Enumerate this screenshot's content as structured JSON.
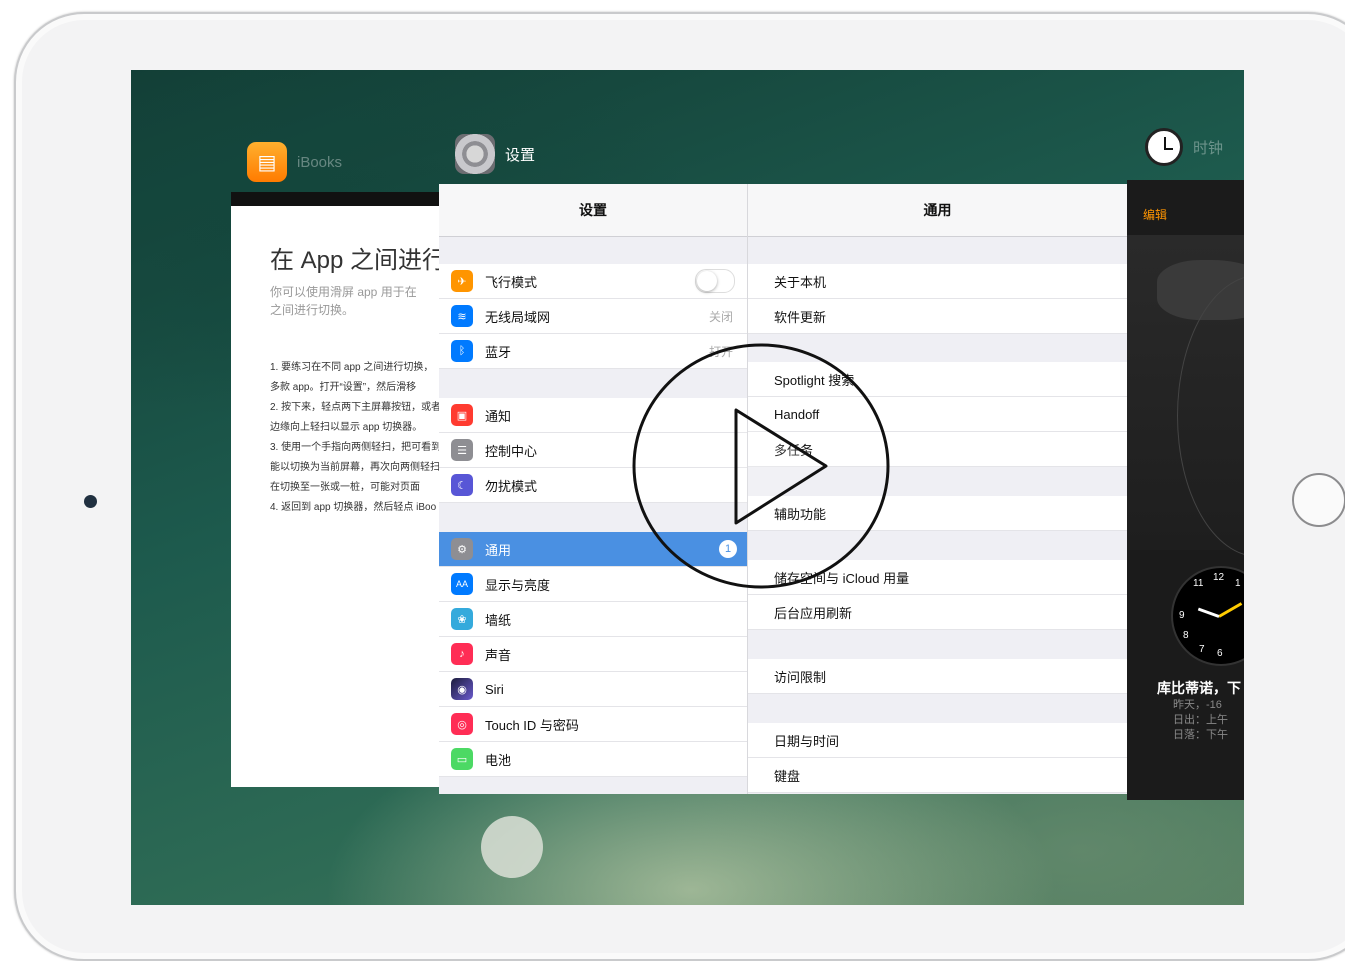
{
  "apps": {
    "ibooks": {
      "name": "iBooks",
      "title": "在 App 之间进行",
      "subtitle_lines": [
        "你可以使用滑屏 app 用于在",
        "之间进行切换。"
      ],
      "list": [
        "1. 要练习在不同 app 之间进行切换，",
        "多款 app。打开“设置”，然后滑移",
        "2. 按下来，轻点两下主屏幕按钮，或者",
        "边缘向上轻扫以显示 app 切换器。",
        "3. 使用一个手指向两侧轻扫，把可看到",
        "能以切换为当前屏幕，再次向两侧轻扫",
        "在切换至一张或一桩，可能对页面",
        "4. 返回到 app 切换器，然后轻点 iBoo"
      ]
    },
    "settings": {
      "name": "设置",
      "master_title": "设置",
      "detail_title": "通用",
      "rows": [
        {
          "label": "飞行模式",
          "value": "",
          "color": "#ff9500",
          "icon": "airplane-icon",
          "glyph": "✈"
        },
        {
          "label": "无线局域网",
          "value": "关闭",
          "color": "#007aff",
          "icon": "wifi-icon",
          "glyph": "≋"
        },
        {
          "label": "蓝牙",
          "value": "打开",
          "color": "#007aff",
          "icon": "bluetooth-icon",
          "glyph": "ᛒ"
        },
        {
          "label": "通知",
          "value": "",
          "color": "#ff3b30",
          "icon": "notification-icon",
          "glyph": "▣"
        },
        {
          "label": "控制中心",
          "value": "",
          "color": "#8e8e93",
          "icon": "control-center-icon",
          "glyph": "☰"
        },
        {
          "label": "勿扰模式",
          "value": "",
          "color": "#5856d6",
          "icon": "moon-icon",
          "glyph": "☾"
        },
        {
          "label": "通用",
          "value": "",
          "badge": "1",
          "color": "#8e8e93",
          "icon": "gear-icon",
          "glyph": "⚙"
        },
        {
          "label": "显示与亮度",
          "value": "",
          "color": "#007aff",
          "icon": "brightness-icon",
          "glyph": "AA"
        },
        {
          "label": "墙纸",
          "value": "",
          "color": "#34aadc",
          "icon": "wallpaper-icon",
          "glyph": "❀"
        },
        {
          "label": "声音",
          "value": "",
          "color": "#ff2d55",
          "icon": "sound-icon",
          "glyph": "♪"
        },
        {
          "label": "Siri",
          "value": "",
          "color": "#1c1c3c",
          "icon": "siri-icon",
          "glyph": "◉"
        },
        {
          "label": "Touch ID 与密码",
          "value": "",
          "color": "#ff2d55",
          "icon": "fingerprint-icon",
          "glyph": "◎"
        },
        {
          "label": "电池",
          "value": "",
          "color": "#4cd964",
          "icon": "battery-icon",
          "glyph": "▭"
        }
      ],
      "detail_rows": [
        "关于本机",
        "软件更新",
        "Spotlight 搜索",
        "Handoff",
        "多任务",
        "辅助功能",
        "储存空间与 iCloud 用量",
        "后台应用刷新",
        "访问限制",
        "日期与时间",
        "键盘"
      ]
    },
    "clock": {
      "name": "时钟",
      "edit": "编辑",
      "city": "库比蒂诺，下",
      "sub_lines": [
        "昨天，-16",
        "日出：上午",
        "日落：下午"
      ],
      "numerals": [
        "12",
        "11",
        "1",
        "9",
        "8",
        "7",
        "6"
      ]
    }
  }
}
